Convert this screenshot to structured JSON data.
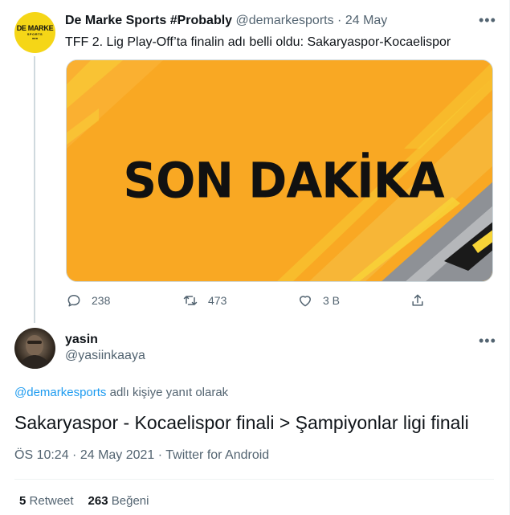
{
  "parent_tweet": {
    "avatar": {
      "logo_main": "DE MARKE",
      "logo_sub": "SPORTS",
      "logo_dots": "●●●"
    },
    "author_name": "De Marke Sports #Probably",
    "author_handle": "@demarkesports",
    "separator": "·",
    "date": "24 May",
    "more_label": "•••",
    "text": "TFF 2. Lig Play-Off’ta finalin adı belli oldu: Sakaryaspor-Kocaelispor",
    "media": {
      "headline": "SON DAKİKA",
      "colors": {
        "orange": "#f9a823",
        "yellow": "#f7d437",
        "gray": "#8e9196",
        "dark": "#1a1a1a"
      }
    },
    "actions": {
      "reply_count": "238",
      "retweet_count": "473",
      "like_count": "3 B"
    }
  },
  "reply_tweet": {
    "author_name": "yasin",
    "author_handle": "@yasiinkaaya",
    "more_label": "•••",
    "replying_mention": "@demarkesports",
    "replying_suffix": " adlı kişiye yanıt olarak",
    "text": "Sakaryaspor - Kocaelispor finali > Şampiyonlar ligi finali",
    "meta": "ÖS 10:24 · 24 May 2021 · Twitter for Android",
    "stats": {
      "retweets_count": "5",
      "retweets_label": "Retweet",
      "likes_count": "263",
      "likes_label": "Beğeni"
    }
  },
  "colors": {
    "link": "#1d9bf0",
    "secondary_text": "#536471",
    "primary_text": "#0f1419",
    "border": "#eff3f4"
  }
}
